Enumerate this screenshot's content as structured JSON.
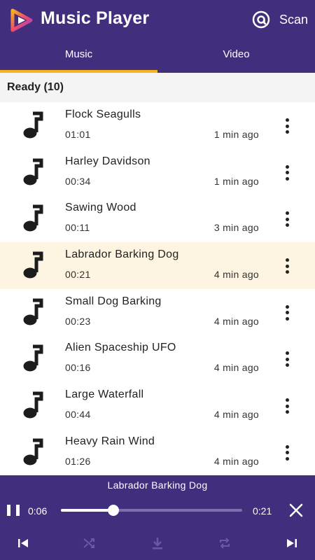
{
  "app": {
    "title": "Music Player",
    "scan_label": "Scan",
    "logo_icon": "play-triangle-logo-icon",
    "colors": {
      "primary": "#412e7c",
      "accent": "#f5b520",
      "active_row": "#fdf4e1"
    }
  },
  "tabs": [
    {
      "label": "Music",
      "selected": true
    },
    {
      "label": "Video",
      "selected": false
    }
  ],
  "section": {
    "header": "Ready (10)"
  },
  "songs": [
    {
      "title": "Flock Seagulls",
      "duration": "01:01",
      "added": "1 min ago",
      "active": false
    },
    {
      "title": "Harley Davidson",
      "duration": "00:34",
      "added": "1 min ago",
      "active": false
    },
    {
      "title": "Sawing Wood",
      "duration": "00:11",
      "added": "3 min ago",
      "active": false
    },
    {
      "title": "Labrador Barking Dog",
      "duration": "00:21",
      "added": "4 min ago",
      "active": true
    },
    {
      "title": "Small Dog Barking",
      "duration": "00:23",
      "added": "4 min ago",
      "active": false
    },
    {
      "title": "Alien Spaceship UFO",
      "duration": "00:16",
      "added": "4 min ago",
      "active": false
    },
    {
      "title": "Large Waterfall",
      "duration": "00:44",
      "added": "4 min ago",
      "active": false
    },
    {
      "title": "Heavy Rain Wind",
      "duration": "01:26",
      "added": "4 min ago",
      "active": false
    }
  ],
  "player": {
    "now_playing": "Labrador Barking Dog",
    "current_time": "0:06",
    "total_time": "0:21",
    "progress_fraction": 0.29,
    "state": "playing"
  }
}
